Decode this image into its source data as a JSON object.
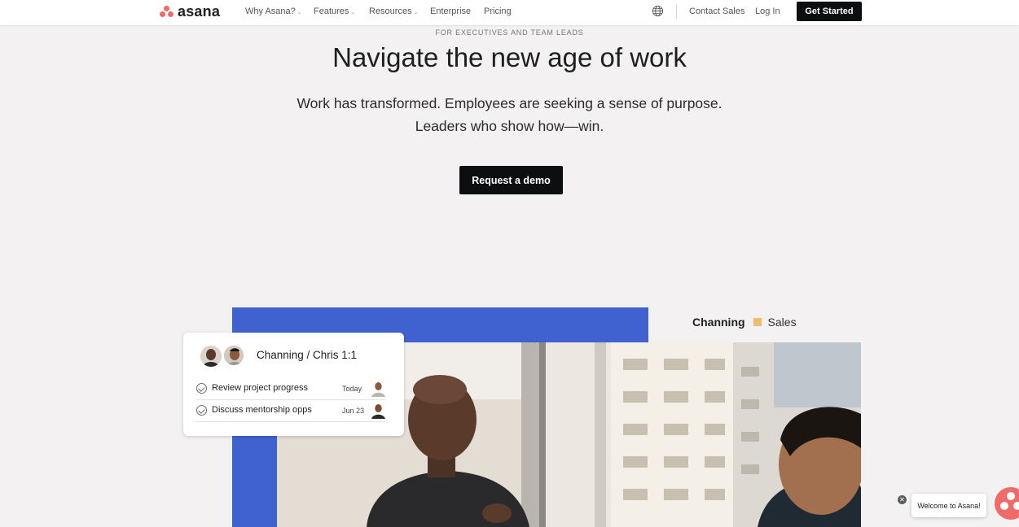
{
  "header": {
    "logo_text": "asana",
    "nav_items": [
      {
        "label": "Why Asana?",
        "dropdown": true
      },
      {
        "label": "Features",
        "dropdown": true
      },
      {
        "label": "Resources",
        "dropdown": true
      },
      {
        "label": "Enterprise",
        "dropdown": false
      },
      {
        "label": "Pricing",
        "dropdown": false
      }
    ],
    "globe_icon": "globe-icon",
    "contact_sales": "Contact Sales",
    "log_in": "Log In",
    "get_started": "Get Started"
  },
  "hero": {
    "eyebrow": "FOR EXECUTIVES AND TEAM LEADS",
    "title": "Navigate the new age of work",
    "subtitle_line1": "Work has transformed. Employees are seeking a sense of purpose.",
    "subtitle_line2": "Leaders who show how—win.",
    "cta": "Request a demo"
  },
  "visual": {
    "tag_name": "Channing",
    "tag_team": "Sales",
    "tag_color": "#f1bd6c",
    "panel_color": "#3f62d0",
    "card": {
      "title": "Channing / Chris 1:1",
      "tasks": [
        {
          "label": "Review project progress",
          "date": "Today"
        },
        {
          "label": "Discuss mentorship opps",
          "date": "Jun 23"
        }
      ]
    }
  },
  "chat": {
    "greeting": "Welcome to Asana!",
    "close_icon": "close-icon"
  },
  "colors": {
    "brand": "#f06a6a",
    "background": "#f3f1f1",
    "button": "#0d0e10"
  }
}
